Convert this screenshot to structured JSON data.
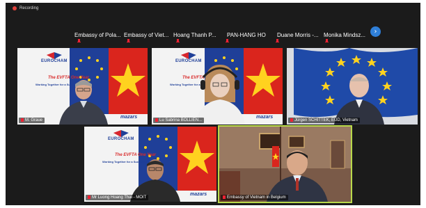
{
  "window": {
    "recording_label": "Recording"
  },
  "participants_strip": [
    {
      "name": "Embassy of Pola..."
    },
    {
      "name": "Embassy of Viet..."
    },
    {
      "name": "Hoang Thanh P..."
    },
    {
      "name": "PAN-HANG HO"
    },
    {
      "name": "Duane Morris -..."
    },
    {
      "name": "Monika Mindsz..."
    }
  ],
  "colors": {
    "background": "#1b1b1b",
    "active_speaker_border": "#b9d94a",
    "next_button": "#2f7fd8",
    "eu_blue": "#1f3f98",
    "eu_star": "#ffd21f",
    "vn_red": "#da251d"
  },
  "icons": {
    "recording": "recording-dot-icon",
    "mic_muted": "mic-muted-icon",
    "next_page": "chevron-right-icon"
  },
  "tiles": [
    {
      "label": "M. Graue",
      "banner": {
        "brand": "EUROCHAM",
        "title": "The EVFTA One Year",
        "subtitle": "Working Together for a Successful Impl",
        "partner": "mazars"
      }
    },
    {
      "label": "Lu Sabrina BOLLIEN...",
      "banner": {
        "brand": "EUROCHAM",
        "title": "The EVFTA One Year",
        "subtitle": "Working Together for a Successful Impl",
        "partner": "mazars"
      }
    },
    {
      "label": "Jürgen SCHITTEK, EUD, Vietnam"
    },
    {
      "label": "Mr Luong Hoang Thai - MOIT",
      "banner": {
        "brand": "EUROCHAM",
        "title": "The EVFTA One Year",
        "subtitle": "Working Together for a Successful Impl",
        "partner": "mazars"
      }
    },
    {
      "label": "Embassy of Vietnam in Belgium"
    }
  ]
}
